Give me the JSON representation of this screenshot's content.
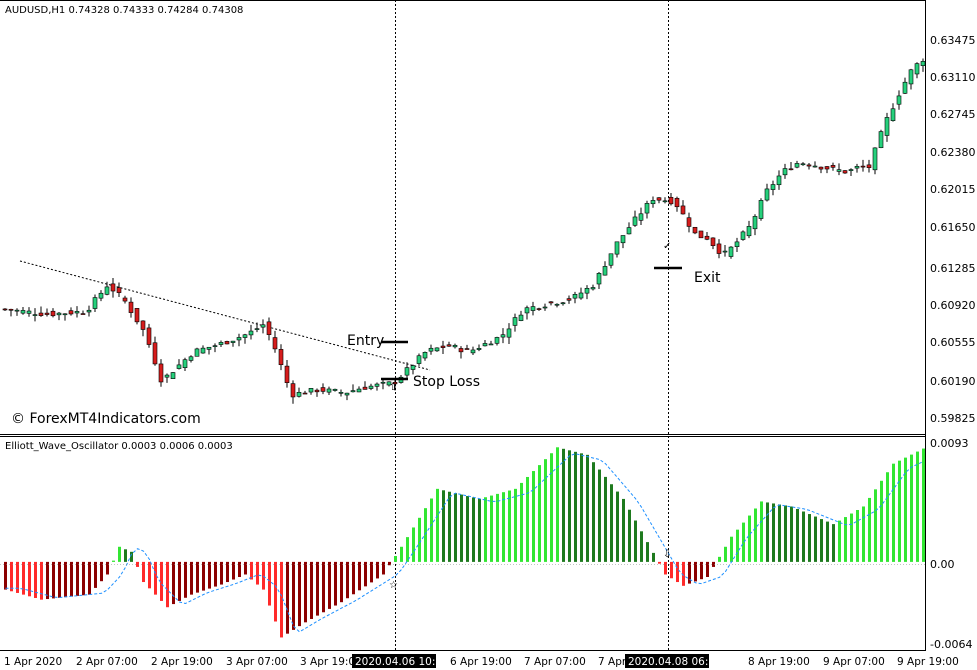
{
  "chart_data": [
    {
      "type": "candlestick",
      "header": "AUDUSD,H1  0.74328 0.74333 0.74284 0.74308",
      "watermark": "© ForexMT4Indicators.com",
      "y_ticks": [
        "0.63475",
        "0.63110",
        "0.62745",
        "0.62380",
        "0.62015",
        "0.61650",
        "0.61285",
        "0.60920",
        "0.60555",
        "0.60190",
        "0.59825"
      ],
      "ylim": [
        0.5964,
        0.6384
      ],
      "annotations": [
        {
          "text": "Entry",
          "price": 0.6058
        },
        {
          "text": "Stop Loss",
          "price": 0.6022
        },
        {
          "text": "Exit",
          "price": 0.6128
        }
      ],
      "key_points": [
        {
          "label": "start",
          "close": 0.6085
        },
        {
          "label": "swing low 2-3 Apr",
          "low": 0.5983
        },
        {
          "label": "entry 6 Apr 10:00",
          "close": 0.6058
        },
        {
          "label": "swing high 7 Apr",
          "high": 0.6213
        },
        {
          "label": "pullback 8 Apr 06:00",
          "low": 0.6124
        },
        {
          "label": "last",
          "close": 0.634
        }
      ]
    },
    {
      "type": "bar",
      "header": "Elliott_Wave_Oscillator 0.0003 0.0006 0.0003",
      "y_ticks": [
        "0.0093",
        "0.00",
        "-0.0064"
      ],
      "ylim": [
        -0.0066,
        0.0096
      ],
      "series": [
        {
          "key": "rising-positive",
          "color": "#32e632"
        },
        {
          "key": "falling-positive",
          "color": "#1e7a1e"
        },
        {
          "key": "falling-negative",
          "color": "#ff2a2a"
        },
        {
          "key": "rising-negative",
          "color": "#8b0000"
        },
        {
          "key": "signal",
          "color": "#1e90ff"
        }
      ],
      "key_points": [
        {
          "label": "first trough",
          "value": -0.003
        },
        {
          "label": "small positive",
          "value": 0.0013
        },
        {
          "label": "second trough",
          "value": -0.006
        },
        {
          "label": "cross up at entry",
          "value": 0.0
        },
        {
          "label": "peak",
          "value": 0.0091
        },
        {
          "label": "cross down",
          "value": -0.0019
        },
        {
          "label": "end",
          "value": 0.009
        }
      ]
    }
  ],
  "x_axis": {
    "labels": [
      "1 Apr 2020",
      "2 Apr 07:00",
      "2 Apr 19:00",
      "3 Apr 07:00",
      "3 Apr 19:00",
      "2020.04.06 10:00",
      "6 Apr 19:00",
      "7 Apr 07:00",
      "7 Apr 19:00",
      "2020.04.08 06:00",
      "8 Apr 19:00",
      "9 Apr 07:00",
      "9 Apr 19:00"
    ],
    "highlighted": [
      "2020.04.06 10:00",
      "2020.04.08 06:00"
    ]
  },
  "colors": {
    "bull": "#26d07c",
    "bear": "#d61c1c",
    "wick": "#000000",
    "background": "#ffffff"
  }
}
